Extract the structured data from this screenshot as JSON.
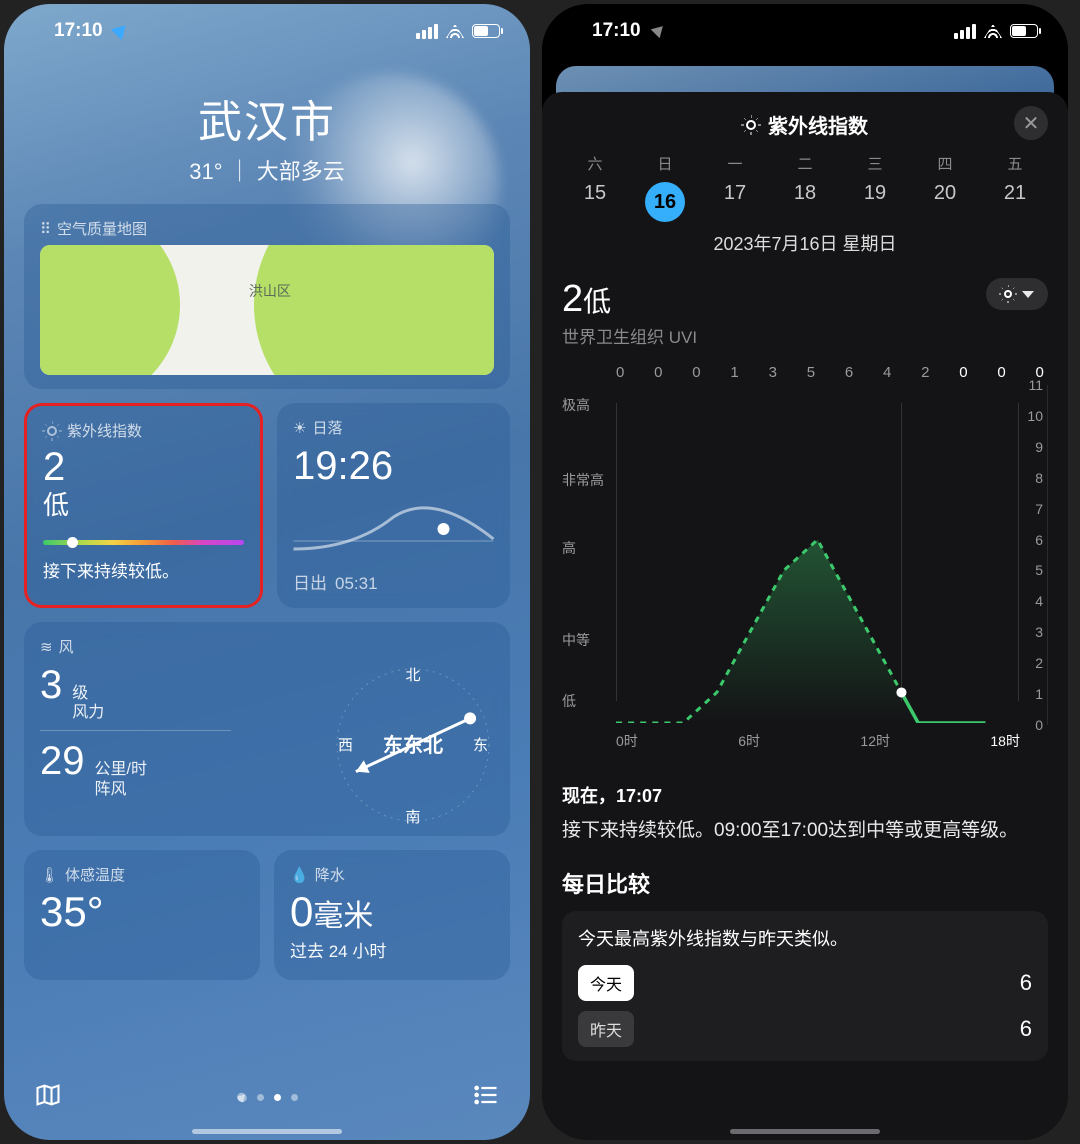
{
  "left": {
    "status": {
      "time": "17:10"
    },
    "city": {
      "name": "武汉市",
      "temp": "31°",
      "sep": "｜",
      "cond": "大部多云"
    },
    "aqi": {
      "title": "空气质量地图",
      "district": "洪山区"
    },
    "uv": {
      "title": "紫外线指数",
      "value": "2",
      "level": "低",
      "note": "接下来持续较低。"
    },
    "sunset": {
      "title": "日落",
      "time": "19:26",
      "sunrise_lbl": "日出",
      "sunrise_time": "05:31"
    },
    "wind": {
      "title": "风",
      "force_val": "3",
      "force_unit_top": "级",
      "force_unit_bot": "风力",
      "gust_val": "29",
      "gust_unit_top": "公里/时",
      "gust_unit_bot": "阵风",
      "n": "北",
      "e": "东",
      "s": "南",
      "w": "西",
      "dir": "东东北"
    },
    "feels": {
      "title": "体感温度",
      "value": "35°"
    },
    "precip": {
      "title": "降水",
      "value": "0",
      "unit": "毫米",
      "sub": "过去 24 小时"
    }
  },
  "right": {
    "status": {
      "time": "17:10"
    },
    "sheet_title": "紫外线指数",
    "days": {
      "wd": [
        "六",
        "日",
        "一",
        "二",
        "三",
        "四",
        "五"
      ],
      "num": [
        "15",
        "16",
        "17",
        "18",
        "19",
        "20",
        "21"
      ],
      "selected_index": 1
    },
    "date_full": "2023年7月16日 星期日",
    "uv_now_val": "2",
    "uv_now_lvl": "低",
    "uv_source": "世界卫生组织 UVI",
    "top_nums": [
      "0",
      "0",
      "0",
      "1",
      "3",
      "5",
      "6",
      "4",
      "2",
      "0",
      "0",
      "0"
    ],
    "y_cat": {
      "extreme": "极高",
      "very_high": "非常高",
      "high": "高",
      "moderate": "中等",
      "low": "低"
    },
    "y_ticks": [
      "11",
      "10",
      "9",
      "8",
      "7",
      "6",
      "5",
      "4",
      "3",
      "2",
      "1",
      "0"
    ],
    "x_labels": [
      "0时",
      "6时",
      "12时",
      "18时"
    ],
    "now_label": "现在，17:07",
    "now_desc": "接下来持续较低。09:00至17:00达到中等或更高等级。",
    "daily_title": "每日比较",
    "daily_lead": "今天最高紫外线指数与昨天类似。",
    "today_lbl": "今天",
    "today_val": "6",
    "yday_lbl": "昨天",
    "yday_val": "6"
  },
  "chart_data": {
    "type": "line",
    "title": "紫外线指数",
    "ylabel": "UVI",
    "ylim": [
      0,
      11
    ],
    "x_hours": [
      0,
      2,
      4,
      6,
      8,
      10,
      12,
      14,
      16,
      18,
      20,
      22
    ],
    "values": [
      0,
      0,
      0,
      1,
      3,
      5,
      6,
      4,
      2,
      0,
      0,
      0
    ],
    "now_hour": 17,
    "now_value": 2,
    "y_category_labels": {
      "low": "低",
      "moderate": "中等",
      "high": "高",
      "very_high": "非常高",
      "extreme": "极高"
    }
  }
}
